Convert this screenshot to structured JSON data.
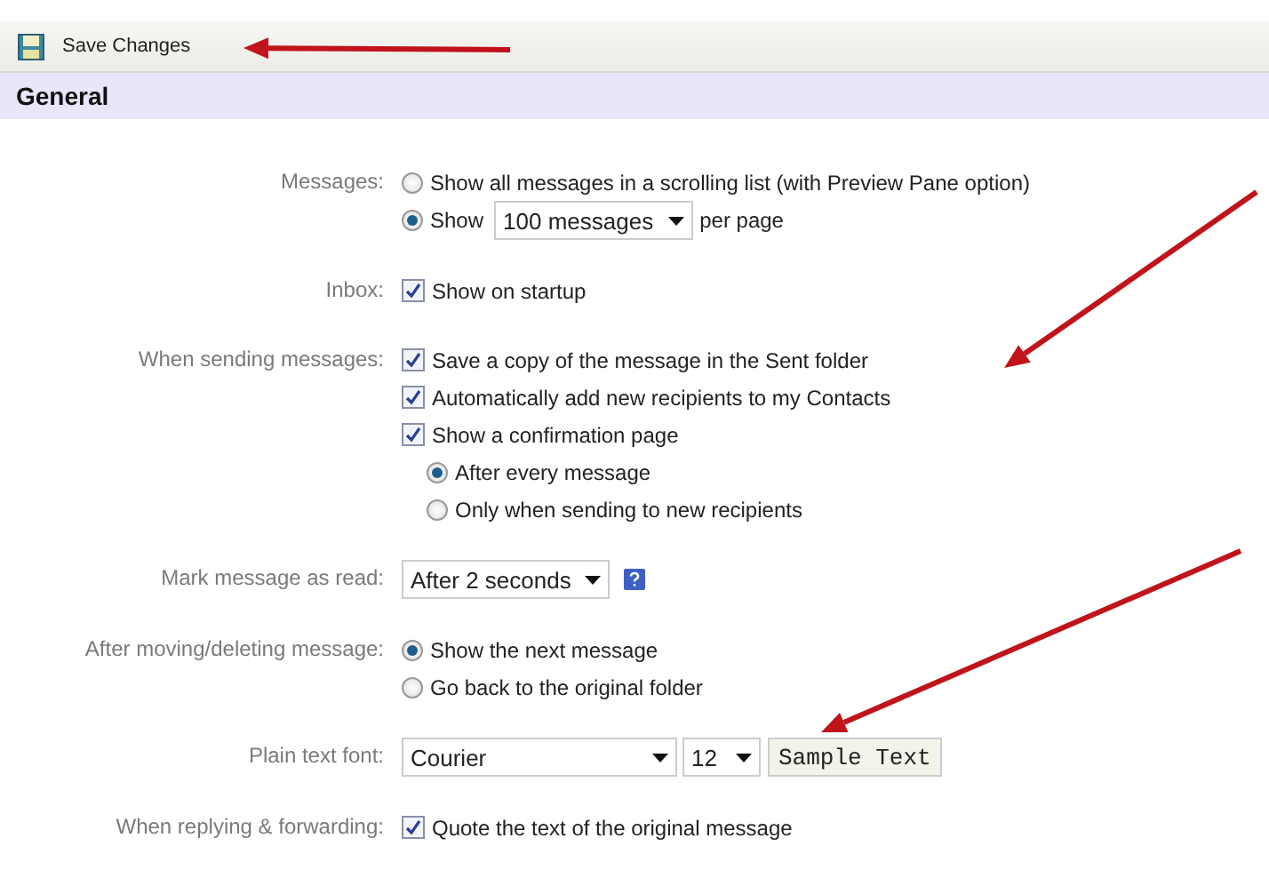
{
  "toolbar": {
    "save_label": "Save Changes"
  },
  "section": {
    "title": "General"
  },
  "settings": [
    {
      "label": "Messages:",
      "controls": [
        {
          "kind": "radio",
          "text": "Show all messages in a scrolling list (with Preview Pane option)",
          "selected": false
        },
        {
          "kind": "radio",
          "text": "Show",
          "selected": true,
          "dropdown": "100 messages",
          "suffix": "per page"
        }
      ]
    },
    {
      "label": "Inbox:",
      "controls": [
        {
          "kind": "checkbox",
          "text": "Show on startup",
          "checked": true
        }
      ]
    },
    {
      "label": "When sending messages:",
      "controls": [
        {
          "kind": "checkbox",
          "text": "Save a copy of the message in the Sent folder",
          "checked": true
        },
        {
          "kind": "checkbox",
          "text": "Automatically add new recipients to my Contacts",
          "checked": true
        },
        {
          "kind": "checkbox",
          "text": "Show a confirmation page",
          "checked": true,
          "children": [
            {
              "kind": "radio",
              "text": "After every message",
              "selected": true
            },
            {
              "kind": "radio",
              "text": "Only when sending to new recipients",
              "selected": false
            }
          ]
        }
      ]
    },
    {
      "label": "Mark message as read:",
      "controls": [
        {
          "kind": "dropdown",
          "value": "After 2 seconds",
          "help": true
        }
      ]
    },
    {
      "label": "After moving/deleting message:",
      "controls": [
        {
          "kind": "radio",
          "text": "Show the next message",
          "selected": true
        },
        {
          "kind": "radio",
          "text": "Go back to the original folder",
          "selected": false
        }
      ]
    },
    {
      "label": "Plain text font:",
      "controls": [
        {
          "kind": "font",
          "font": "Courier",
          "size": "12",
          "sample": "Sample Text"
        }
      ]
    },
    {
      "label": "When replying & forwarding:",
      "controls": [
        {
          "kind": "checkbox",
          "text": "Quote the text of the original message",
          "checked": true
        }
      ]
    }
  ]
}
